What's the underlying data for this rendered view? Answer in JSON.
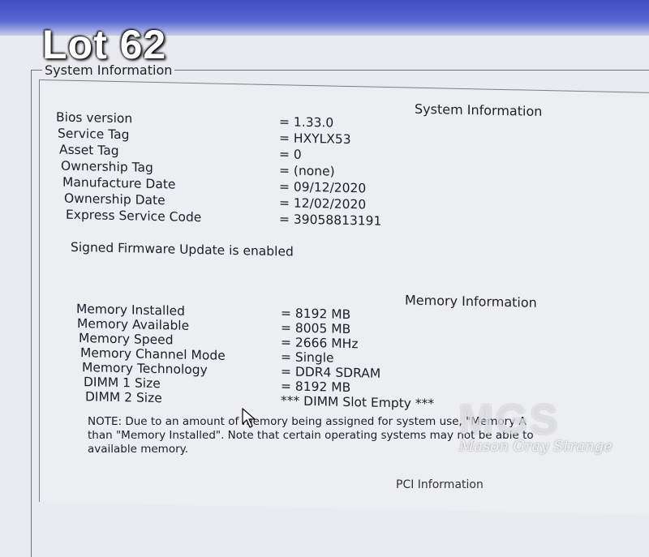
{
  "overlay": {
    "lot_label": "Lot 62"
  },
  "group": {
    "title": "System Information"
  },
  "system": {
    "heading": "System Information",
    "rows": [
      {
        "label": "Bios version",
        "value": "= 1.33.0"
      },
      {
        "label": "Service Tag",
        "value": "= HXYLX53"
      },
      {
        "label": "Asset Tag",
        "value": "= 0"
      },
      {
        "label": "Ownership Tag",
        "value": "= (none)"
      },
      {
        "label": "Manufacture Date",
        "value": "= 09/12/2020"
      },
      {
        "label": "Ownership Date",
        "value": "= 12/02/2020"
      },
      {
        "label": "Express Service Code",
        "value": "= 39058813191"
      }
    ],
    "firmware_status": "Signed Firmware Update is enabled"
  },
  "memory": {
    "heading": "Memory Information",
    "rows": [
      {
        "label": "Memory Installed",
        "value": "= 8192 MB"
      },
      {
        "label": "Memory Available",
        "value": "= 8005 MB"
      },
      {
        "label": "Memory Speed",
        "value": "= 2666 MHz"
      },
      {
        "label": "Memory Channel Mode",
        "value": "= Single"
      },
      {
        "label": "Memory Technology",
        "value": "= DDR4 SDRAM"
      },
      {
        "label": "DIMM 1 Size",
        "value": "= 8192 MB"
      },
      {
        "label": "DIMM 2 Size",
        "value": "*** DIMM Slot Empty ***"
      }
    ],
    "note": "NOTE: Due to an amount of memory being assigned for system use, \"Memory A\nthan \"Memory Installed\". Note that certain operating systems may not be able to\navailable memory."
  },
  "pci": {
    "heading": "PCI Information"
  },
  "watermark": {
    "logo": "MGS",
    "text": "Mason Gray Strange"
  },
  "colors": {
    "title_band": "#4a58c8",
    "panel_bg": "#eceef2",
    "text": "#1c1f2a"
  }
}
